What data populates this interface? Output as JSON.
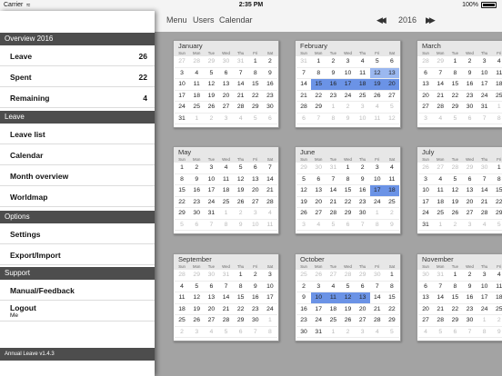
{
  "status_bar": {
    "carrier": "Carrier",
    "time": "2:35 PM",
    "battery": "100%"
  },
  "sidebar": {
    "overview_title": "Overview 2016",
    "overview": [
      {
        "label": "Leave",
        "value": "26"
      },
      {
        "label": "Spent",
        "value": "22"
      },
      {
        "label": "Remaining",
        "value": "4"
      }
    ],
    "leave_title": "Leave",
    "leave_items": [
      "Leave list",
      "Calendar",
      "Month overview",
      "Worldmap"
    ],
    "options_title": "Options",
    "options_items": [
      "Settings",
      "Export/Import"
    ],
    "support_title": "Support",
    "support_items": [
      "Manual/Feedback"
    ],
    "logout": {
      "label": "Logout",
      "user": "Me"
    },
    "footer": "Annual Leave v1.4.3"
  },
  "topbar": {
    "menu": "Menu",
    "users": "Users",
    "calendar": "Calendar",
    "year": "2016"
  },
  "weekdays": [
    "Sun",
    "Mon",
    "Tue",
    "Wed",
    "Thu",
    "Fri",
    "Sat"
  ],
  "colors": {
    "section": "#4d4d4d",
    "highlight": "#9bb8f0",
    "highlight_dark": "#6b93e6",
    "calendar_bg": "#a3a3a3"
  },
  "months": [
    {
      "name": "January",
      "col": 0,
      "rowp": 0,
      "weeks": [
        [
          "27",
          "28",
          "29",
          "30",
          "31",
          "1",
          "2"
        ],
        [
          "3",
          "4",
          "5",
          "6",
          "7",
          "8",
          "9"
        ],
        [
          "10",
          "11",
          "12",
          "13",
          "14",
          "15",
          "16"
        ],
        [
          "17",
          "18",
          "19",
          "20",
          "21",
          "22",
          "23"
        ],
        [
          "24",
          "25",
          "26",
          "27",
          "28",
          "29",
          "30"
        ],
        [
          "31",
          "1",
          "2",
          "3",
          "4",
          "5",
          "6"
        ]
      ]
    },
    {
      "name": "February",
      "col": 1,
      "rowp": 0,
      "weeks": [
        [
          "31",
          "1",
          "2",
          "3",
          "4",
          "5",
          "6"
        ],
        [
          "7",
          "8",
          "9",
          "10",
          "11",
          "12",
          "13"
        ],
        [
          "14",
          "15",
          "16",
          "17",
          "18",
          "19",
          "20"
        ],
        [
          "21",
          "22",
          "23",
          "24",
          "25",
          "26",
          "27"
        ],
        [
          "28",
          "29",
          "1",
          "2",
          "3",
          "4",
          "5"
        ],
        [
          "6",
          "7",
          "8",
          "9",
          "10",
          "11",
          "12"
        ]
      ]
    },
    {
      "name": "March",
      "col": 2,
      "rowp": 0,
      "weeks": [
        [
          "28",
          "29",
          "1",
          "2",
          "3",
          "4",
          "5"
        ],
        [
          "6",
          "7",
          "8",
          "9",
          "10",
          "11",
          "12"
        ],
        [
          "13",
          "14",
          "15",
          "16",
          "17",
          "18",
          "19"
        ],
        [
          "20",
          "21",
          "22",
          "23",
          "24",
          "25",
          "26"
        ],
        [
          "27",
          "28",
          "29",
          "30",
          "31",
          "1",
          "2"
        ],
        [
          "3",
          "4",
          "5",
          "6",
          "7",
          "8",
          "9"
        ]
      ]
    },
    {
      "name": "May",
      "col": 0,
      "rowp": 1,
      "weeks": [
        [
          "1",
          "2",
          "3",
          "4",
          "5",
          "6",
          "7"
        ],
        [
          "8",
          "9",
          "10",
          "11",
          "12",
          "13",
          "14"
        ],
        [
          "15",
          "16",
          "17",
          "18",
          "19",
          "20",
          "21"
        ],
        [
          "22",
          "23",
          "24",
          "25",
          "26",
          "27",
          "28"
        ],
        [
          "29",
          "30",
          "31",
          "1",
          "2",
          "3",
          "4"
        ],
        [
          "5",
          "6",
          "7",
          "8",
          "9",
          "10",
          "11"
        ]
      ]
    },
    {
      "name": "June",
      "col": 1,
      "rowp": 1,
      "weeks": [
        [
          "29",
          "30",
          "31",
          "1",
          "2",
          "3",
          "4"
        ],
        [
          "5",
          "6",
          "7",
          "8",
          "9",
          "10",
          "11"
        ],
        [
          "12",
          "13",
          "14",
          "15",
          "16",
          "17",
          "18"
        ],
        [
          "19",
          "20",
          "21",
          "22",
          "23",
          "24",
          "25"
        ],
        [
          "26",
          "27",
          "28",
          "29",
          "30",
          "1",
          "2"
        ],
        [
          "3",
          "4",
          "5",
          "6",
          "7",
          "8",
          "9"
        ]
      ]
    },
    {
      "name": "July",
      "col": 2,
      "rowp": 1,
      "weeks": [
        [
          "26",
          "27",
          "28",
          "29",
          "30",
          "1",
          "2"
        ],
        [
          "3",
          "4",
          "5",
          "6",
          "7",
          "8",
          "9"
        ],
        [
          "10",
          "11",
          "12",
          "13",
          "14",
          "15",
          "16"
        ],
        [
          "17",
          "18",
          "19",
          "20",
          "21",
          "22",
          "23"
        ],
        [
          "24",
          "25",
          "26",
          "27",
          "28",
          "29",
          "30"
        ],
        [
          "31",
          "1",
          "2",
          "3",
          "4",
          "5",
          "6"
        ]
      ]
    },
    {
      "name": "September",
      "col": 0,
      "rowp": 2,
      "weeks": [
        [
          "28",
          "29",
          "30",
          "31",
          "1",
          "2",
          "3"
        ],
        [
          "4",
          "5",
          "6",
          "7",
          "8",
          "9",
          "10"
        ],
        [
          "11",
          "12",
          "13",
          "14",
          "15",
          "16",
          "17"
        ],
        [
          "18",
          "19",
          "20",
          "21",
          "22",
          "23",
          "24"
        ],
        [
          "25",
          "26",
          "27",
          "28",
          "29",
          "30",
          "1"
        ],
        [
          "2",
          "3",
          "4",
          "5",
          "6",
          "7",
          "8"
        ]
      ]
    },
    {
      "name": "October",
      "col": 1,
      "rowp": 2,
      "weeks": [
        [
          "25",
          "26",
          "27",
          "28",
          "29",
          "30",
          "1"
        ],
        [
          "2",
          "3",
          "4",
          "5",
          "6",
          "7",
          "8"
        ],
        [
          "9",
          "10",
          "11",
          "12",
          "13",
          "14",
          "15"
        ],
        [
          "16",
          "17",
          "18",
          "19",
          "20",
          "21",
          "22"
        ],
        [
          "23",
          "24",
          "25",
          "26",
          "27",
          "28",
          "29"
        ],
        [
          "30",
          "31",
          "1",
          "2",
          "3",
          "4",
          "5"
        ]
      ]
    },
    {
      "name": "November",
      "col": 2,
      "rowp": 2,
      "weeks": [
        [
          "30",
          "31",
          "1",
          "2",
          "3",
          "4",
          "5"
        ],
        [
          "6",
          "7",
          "8",
          "9",
          "10",
          "11",
          "12"
        ],
        [
          "13",
          "14",
          "15",
          "16",
          "17",
          "18",
          "19"
        ],
        [
          "20",
          "21",
          "22",
          "23",
          "24",
          "25",
          "26"
        ],
        [
          "27",
          "28",
          "29",
          "30",
          "1",
          "2",
          "3"
        ],
        [
          "4",
          "5",
          "6",
          "7",
          "8",
          "9",
          "10"
        ]
      ]
    }
  ]
}
